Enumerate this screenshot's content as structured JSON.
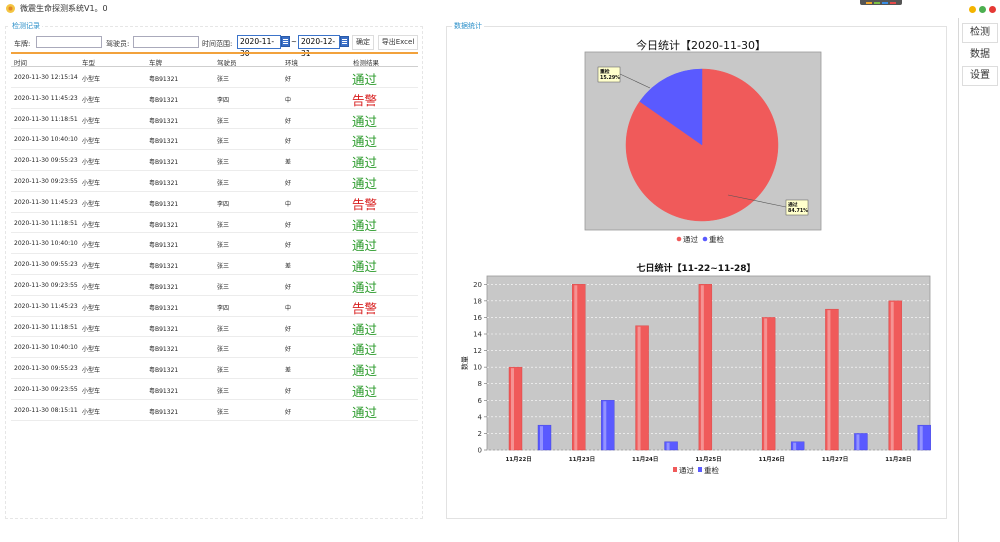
{
  "window": {
    "title": "微震生命探测系统V1。0"
  },
  "records": {
    "group_title": "检测记录",
    "filters": {
      "plate_label": "车牌:",
      "plate_value": "",
      "driver_label": "驾驶员:",
      "driver_value": "",
      "time_range_label": "时间范围:",
      "date_from": "2020-11-30",
      "range_sep": "~",
      "date_to": "2020-12-31",
      "confirm_label": "确定",
      "export_label": "导出Excel"
    },
    "columns": [
      "时间",
      "车型",
      "车牌",
      "驾驶员",
      "环境",
      "检测结果"
    ],
    "rows": [
      {
        "time": "2020-11-30 12:15:14",
        "type": "小型车",
        "plate": "粤B91321",
        "driver": "张三",
        "env": "好",
        "result": "通过",
        "status": "pass"
      },
      {
        "time": "2020-11-30 11:45:23",
        "type": "小型车",
        "plate": "粤B91321",
        "driver": "李四",
        "env": "中",
        "result": "告警",
        "status": "alarm"
      },
      {
        "time": "2020-11-30 11:18:51",
        "type": "小型车",
        "plate": "粤B91321",
        "driver": "张三",
        "env": "好",
        "result": "通过",
        "status": "pass"
      },
      {
        "time": "2020-11-30 10:40:10",
        "type": "小型车",
        "plate": "粤B91321",
        "driver": "张三",
        "env": "好",
        "result": "通过",
        "status": "pass"
      },
      {
        "time": "2020-11-30 09:55:23",
        "type": "小型车",
        "plate": "粤B91321",
        "driver": "张三",
        "env": "差",
        "result": "通过",
        "status": "pass"
      },
      {
        "time": "2020-11-30 09:23:55",
        "type": "小型车",
        "plate": "粤B91321",
        "driver": "张三",
        "env": "好",
        "result": "通过",
        "status": "pass"
      },
      {
        "time": "2020-11-30 11:45:23",
        "type": "小型车",
        "plate": "粤B91321",
        "driver": "李四",
        "env": "中",
        "result": "告警",
        "status": "alarm"
      },
      {
        "time": "2020-11-30 11:18:51",
        "type": "小型车",
        "plate": "粤B91321",
        "driver": "张三",
        "env": "好",
        "result": "通过",
        "status": "pass"
      },
      {
        "time": "2020-11-30 10:40:10",
        "type": "小型车",
        "plate": "粤B91321",
        "driver": "张三",
        "env": "好",
        "result": "通过",
        "status": "pass"
      },
      {
        "time": "2020-11-30 09:55:23",
        "type": "小型车",
        "plate": "粤B91321",
        "driver": "张三",
        "env": "差",
        "result": "通过",
        "status": "pass"
      },
      {
        "time": "2020-11-30 09:23:55",
        "type": "小型车",
        "plate": "粤B91321",
        "driver": "张三",
        "env": "好",
        "result": "通过",
        "status": "pass"
      },
      {
        "time": "2020-11-30 11:45:23",
        "type": "小型车",
        "plate": "粤B91321",
        "driver": "李四",
        "env": "中",
        "result": "告警",
        "status": "alarm"
      },
      {
        "time": "2020-11-30 11:18:51",
        "type": "小型车",
        "plate": "粤B91321",
        "driver": "张三",
        "env": "好",
        "result": "通过",
        "status": "pass"
      },
      {
        "time": "2020-11-30 10:40:10",
        "type": "小型车",
        "plate": "粤B91321",
        "driver": "张三",
        "env": "好",
        "result": "通过",
        "status": "pass"
      },
      {
        "time": "2020-11-30 09:55:23",
        "type": "小型车",
        "plate": "粤B91321",
        "driver": "张三",
        "env": "差",
        "result": "通过",
        "status": "pass"
      },
      {
        "time": "2020-11-30 09:23:55",
        "type": "小型车",
        "plate": "粤B91321",
        "driver": "张三",
        "env": "好",
        "result": "通过",
        "status": "pass"
      },
      {
        "time": "2020-11-30 08:15:11",
        "type": "小型车",
        "plate": "粤B91321",
        "driver": "张三",
        "env": "好",
        "result": "通过",
        "status": "pass"
      }
    ]
  },
  "stats": {
    "group_title": "数据统计"
  },
  "nav": {
    "items": [
      "检测",
      "数据",
      "设置"
    ]
  },
  "colors": {
    "pass": "#f05a5a",
    "recheck": "#5a5aff",
    "plot_bg": "#c8c8c8",
    "accent": "#2a8fc9",
    "pass_text": "#2a9a2a",
    "alarm_text": "#d81e1e"
  },
  "chart_data": [
    {
      "type": "pie",
      "title": "今日统计【2020-11-30】",
      "slices": [
        {
          "name": "通过",
          "value": 84.71,
          "label": "通过\n84.71%"
        },
        {
          "name": "重检",
          "value": 15.29,
          "label": "重检\n15.29%"
        }
      ],
      "legend": [
        "通过",
        "重检"
      ],
      "legend_position": "bottom"
    },
    {
      "type": "bar",
      "title": "七日统计【11-22~11-28】",
      "categories": [
        "11月22日",
        "11月23日",
        "11月24日",
        "11月25日",
        "11月26日",
        "11月27日",
        "11月28日"
      ],
      "series": [
        {
          "name": "通过",
          "values": [
            10,
            20,
            15,
            20,
            16,
            17,
            18
          ]
        },
        {
          "name": "重检",
          "values": [
            3,
            6,
            1,
            0,
            1,
            2,
            3
          ]
        }
      ],
      "ylabel": "数量",
      "ylim": [
        0,
        21
      ],
      "yticks": [
        0,
        2,
        4,
        6,
        8,
        10,
        12,
        14,
        16,
        18,
        20
      ],
      "grid": true,
      "legend_position": "bottom"
    }
  ]
}
